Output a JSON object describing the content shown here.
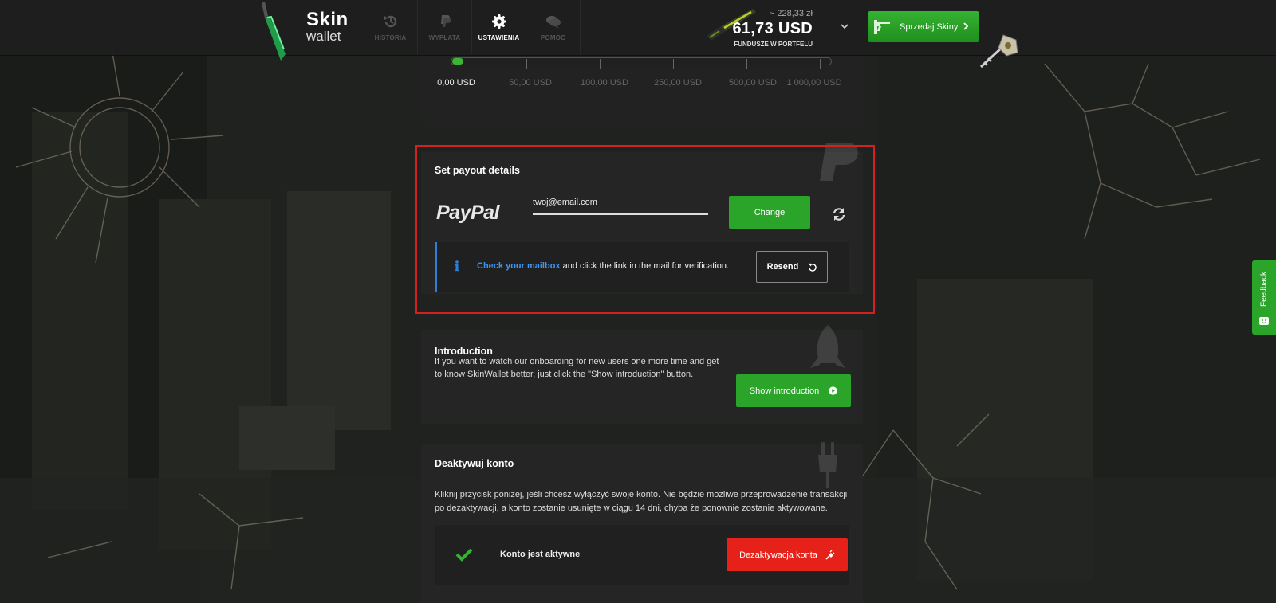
{
  "brand": {
    "line1": "Skin",
    "line2": "wallet"
  },
  "nav": [
    {
      "label": "HISTORIA",
      "icon": "history-icon"
    },
    {
      "label": "WYPŁATA",
      "icon": "paypal-icon"
    },
    {
      "label": "USTAWIENIA",
      "icon": "gear-icon"
    },
    {
      "label": "POMOC",
      "icon": "chat-icon"
    }
  ],
  "wallet": {
    "pln": "~ 228,33 zł",
    "usd": "61,73 USD",
    "caption": "FUNDUSZE W PORTFELU"
  },
  "sell_button": "Sprzedaj Skiny",
  "slider": {
    "labels": [
      "0,00 USD",
      "50,00 USD",
      "100,00 USD",
      "250,00 USD",
      "500,00 USD",
      "1 000,00 USD"
    ],
    "selected_index": 0
  },
  "payout": {
    "title": "Set payout details",
    "provider": "PayPal",
    "email_value": "twoj@email.com",
    "change_label": "Change",
    "info_link": "Check your mailbox",
    "info_rest": " and click the link in the mail for verification.",
    "resend_label": "Resend"
  },
  "introduction": {
    "title": "Introduction",
    "text": "If you want to watch our onboarding for new users one more time and get to know SkinWallet better, just click the \"Show introduction\" button.",
    "button": "Show introduction"
  },
  "deactivate": {
    "title": "Deaktywuj konto",
    "text": "Kliknij przycisk poniżej, jeśli chcesz wyłączyć swoje konto. Nie będzie możliwe przeprowadzenie transakcji po dezaktywacji, a konto zostanie usunięte w ciągu 14 dni, chyba że ponownie zostanie aktywowane.",
    "status": "Konto jest aktywne",
    "button": "Dezaktywacja konta"
  },
  "feedback": "Feedback",
  "colors": {
    "accent_green": "#2aa52a",
    "danger_red": "#e62119",
    "info_blue": "#2f7fd8",
    "highlight_red": "#d12121"
  }
}
